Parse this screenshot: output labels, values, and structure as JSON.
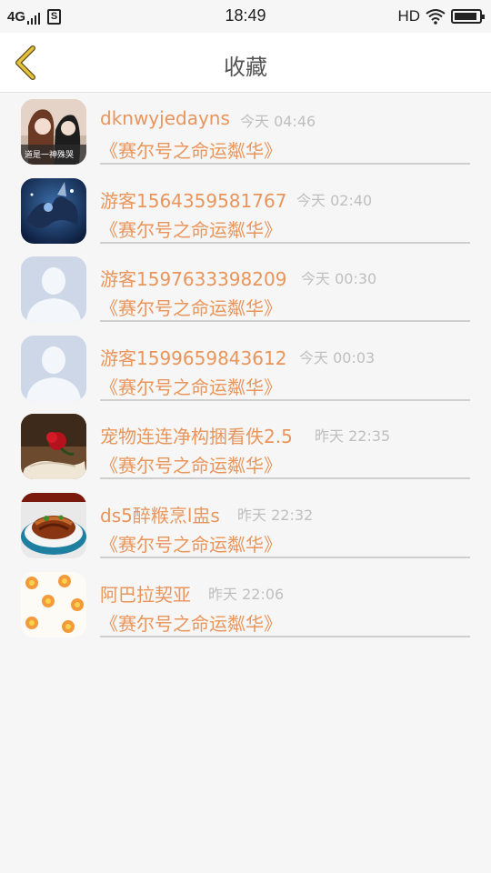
{
  "status_bar": {
    "network": "4G",
    "sim_label": "S",
    "time": "18:49",
    "hd": "HD",
    "battery_level": 0.75
  },
  "header": {
    "title": "收藏",
    "back_icon": "chevron-left-icon",
    "accent_color": "#e6c23a"
  },
  "favorites": {
    "items": [
      {
        "name": "dknwyjedayns",
        "time": "今天 04:46",
        "subtitle": "《赛尔号之命运粼华》",
        "avatar_caption": "道是一神殊哭"
      },
      {
        "name": "游客1564359581767",
        "time": "今天 02:40",
        "subtitle": "《赛尔号之命运粼华》"
      },
      {
        "name": "游客1597633398209",
        "time": "今天 00:30",
        "subtitle": "《赛尔号之命运粼华》"
      },
      {
        "name": "游客1599659843612",
        "time": "今天 00:03",
        "subtitle": "《赛尔号之命运粼华》"
      },
      {
        "name": "宠物连连净构捆看佚2.5",
        "time": "昨天 22:35",
        "subtitle": "《赛尔号之命运粼华》"
      },
      {
        "name": "ds5醉糇烹l盅s",
        "time": "昨天 22:32",
        "subtitle": "《赛尔号之命运粼华》"
      },
      {
        "name": "阿巴拉契亚",
        "time": "昨天 22:06",
        "subtitle": "《赛尔号之命运粼华》"
      }
    ]
  },
  "colors": {
    "name_color": "#e9955b",
    "time_color": "#bfbfbf",
    "background": "#f6f6f6"
  }
}
